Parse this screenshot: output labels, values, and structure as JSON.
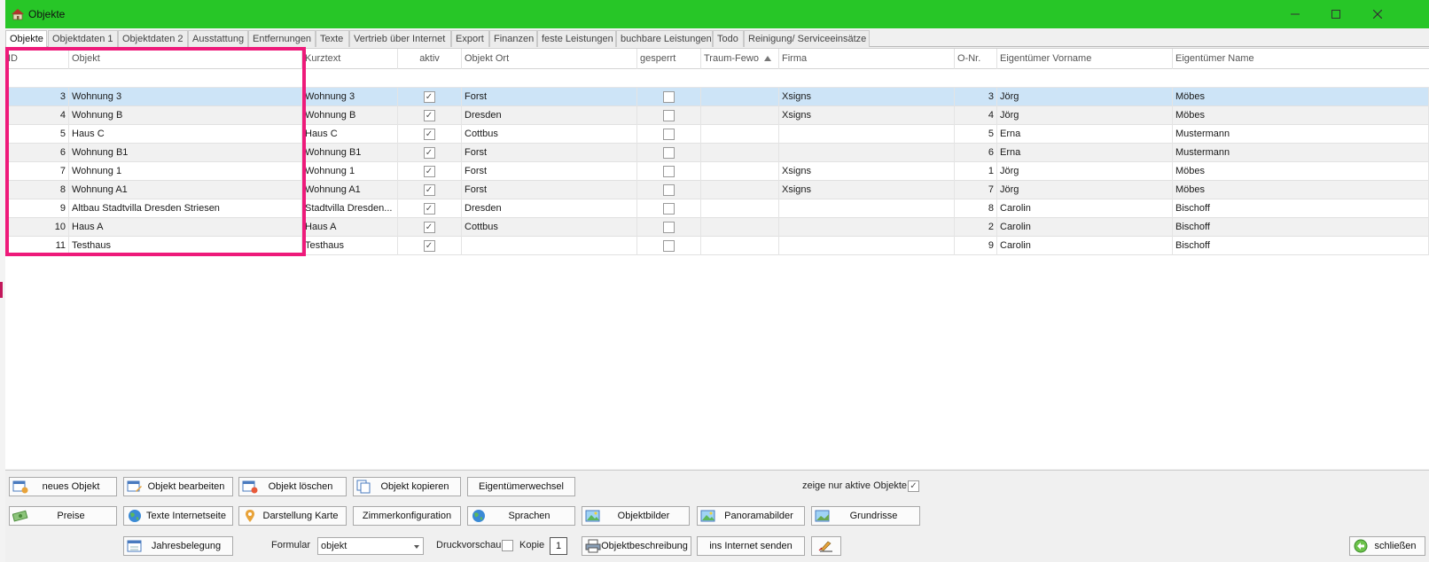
{
  "window": {
    "title": "Objekte"
  },
  "tabs": [
    {
      "label": "Objekte",
      "active": true
    },
    {
      "label": "Objektdaten 1"
    },
    {
      "label": "Objektdaten 2"
    },
    {
      "label": "Ausstattung"
    },
    {
      "label": "Entfernungen"
    },
    {
      "label": "Texte"
    },
    {
      "label": "Vertrieb über Internet"
    },
    {
      "label": "Export"
    },
    {
      "label": "Finanzen"
    },
    {
      "label": "feste Leistungen"
    },
    {
      "label": "buchbare Leistungen"
    },
    {
      "label": "Todo"
    },
    {
      "label": "Reinigung/ Serviceeinsätze"
    }
  ],
  "grid": {
    "columns": [
      "ID",
      "Objekt",
      "Kurztext",
      "aktiv",
      "Objekt Ort",
      "gesperrt",
      "Traum-Fewo",
      "Firma",
      "O-Nr.",
      "Eigentümer Vorname",
      "Eigentümer Name"
    ],
    "sorted_column": "Traum-Fewo",
    "rows": [
      {
        "id": "3",
        "objekt": "Wohnung 3",
        "kurztext": "Wohnung 3",
        "aktiv": true,
        "ort": "Forst",
        "gesperrt": false,
        "fewo": "",
        "firma": "Xsigns",
        "onr": "3",
        "vorname": "Jörg",
        "name": "Möbes",
        "selected": true
      },
      {
        "id": "4",
        "objekt": "Wohnung B",
        "kurztext": "Wohnung B",
        "aktiv": true,
        "ort": "Dresden",
        "gesperrt": false,
        "fewo": "",
        "firma": "Xsigns",
        "onr": "4",
        "vorname": "Jörg",
        "name": "Möbes"
      },
      {
        "id": "5",
        "objekt": "Haus C",
        "kurztext": "Haus C",
        "aktiv": true,
        "ort": "Cottbus",
        "gesperrt": false,
        "fewo": "",
        "firma": "",
        "onr": "5",
        "vorname": "Erna",
        "name": "Mustermann"
      },
      {
        "id": "6",
        "objekt": "Wohnung B1",
        "kurztext": "Wohnung B1",
        "aktiv": true,
        "ort": "Forst",
        "gesperrt": false,
        "fewo": "",
        "firma": "",
        "onr": "6",
        "vorname": "Erna",
        "name": "Mustermann"
      },
      {
        "id": "7",
        "objekt": "Wohnung 1",
        "kurztext": "Wohnung 1",
        "aktiv": true,
        "ort": "Forst",
        "gesperrt": false,
        "fewo": "",
        "firma": "Xsigns",
        "onr": "1",
        "vorname": "Jörg",
        "name": "Möbes"
      },
      {
        "id": "8",
        "objekt": "Wohnung A1",
        "kurztext": "Wohnung A1",
        "aktiv": true,
        "ort": "Forst",
        "gesperrt": false,
        "fewo": "",
        "firma": "Xsigns",
        "onr": "7",
        "vorname": "Jörg",
        "name": "Möbes"
      },
      {
        "id": "9",
        "objekt": "Altbau Stadtvilla Dresden Striesen",
        "kurztext": "Stadtvilla Dresden...",
        "aktiv": true,
        "ort": "Dresden",
        "gesperrt": false,
        "fewo": "",
        "firma": "",
        "onr": "8",
        "vorname": "Carolin",
        "name": "Bischoff"
      },
      {
        "id": "10",
        "objekt": "Haus A",
        "kurztext": "Haus A",
        "aktiv": true,
        "ort": "Cottbus",
        "gesperrt": false,
        "fewo": "",
        "firma": "",
        "onr": "2",
        "vorname": "Carolin",
        "name": "Bischoff"
      },
      {
        "id": "11",
        "objekt": "Testhaus",
        "kurztext": "Testhaus",
        "aktiv": true,
        "ort": "",
        "gesperrt": false,
        "fewo": "",
        "firma": "",
        "onr": "9",
        "vorname": "Carolin",
        "name": "Bischoff"
      }
    ]
  },
  "toolbar": {
    "neues_objekt": "neues Objekt",
    "objekt_bearbeiten": "Objekt bearbeiten",
    "objekt_loeschen": "Objekt löschen",
    "objekt_kopieren": "Objekt kopieren",
    "eigentuemerwechsel": "Eigentümerwechsel",
    "nur_aktive_label": "zeige nur aktive Objekte",
    "nur_aktive_checked": true,
    "preise": "Preise",
    "texte_internetseite": "Texte Internetseite",
    "darstellung_karte": "Darstellung Karte",
    "zimmerkonfiguration": "Zimmerkonfiguration",
    "sprachen": "Sprachen",
    "objektbilder": "Objektbilder",
    "panoramabilder": "Panoramabilder",
    "grundrisse": "Grundrisse",
    "jahresbelegung": "Jahresbelegung",
    "formular_label": "Formular",
    "formular_value": "objekt",
    "druckvorschau_label": "Druckvorschau",
    "druckvorschau_checked": false,
    "kopie_label": "Kopie",
    "kopie_value": "1",
    "objektbeschreibung": "Objektbeschreibung",
    "ins_internet_senden": "ins Internet senden",
    "schliessen": "schließen"
  },
  "colors": {
    "titlebar": "#27c627",
    "selected_row": "#cde4f7",
    "highlight": "#ee1a7a"
  }
}
